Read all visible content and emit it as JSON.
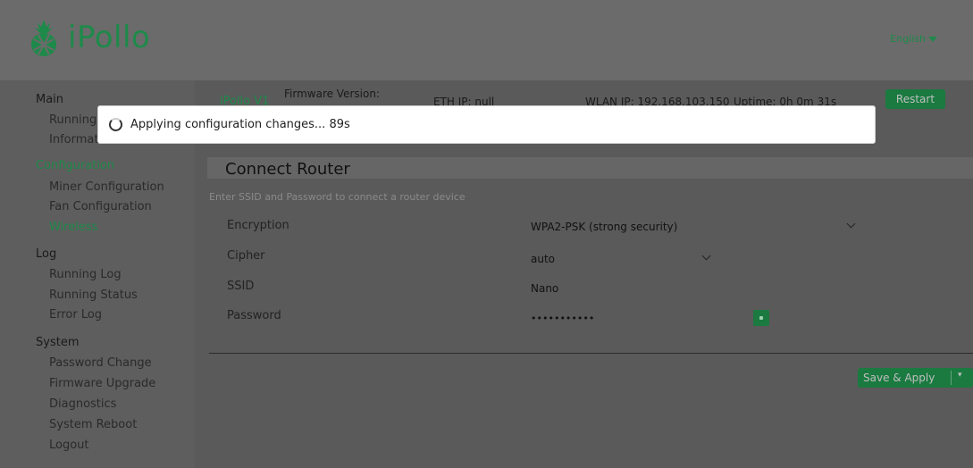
{
  "header": {
    "app_name": "iPollo",
    "language": "English"
  },
  "sidebar": {
    "sections": [
      {
        "label": "Main",
        "items": [
          "Running",
          "Informat"
        ]
      },
      {
        "label": "Configuration",
        "items": [
          "Miner Configuration",
          "Fan Configuration",
          "Wireless"
        ]
      },
      {
        "label": "Log",
        "items": [
          "Running Log",
          "Running Status",
          "Error Log"
        ]
      },
      {
        "label": "System",
        "items": [
          "Password Change",
          "Firmware Upgrade",
          "Diagnostics",
          "System Reboot",
          "Logout"
        ]
      }
    ]
  },
  "status_bar": {
    "model": "iPollo V1",
    "firmware_label": "Firmware Version:",
    "eth_ip": "ETH IP: null",
    "wlan_ip": "WLAN IP: 192.168.103.150",
    "uptime": "Uptime: 0h 0m 31s",
    "restart_label": "Restart"
  },
  "page": {
    "title": "Connect Router",
    "hint": "Enter SSID and Password to connect a router device",
    "fields": [
      {
        "label": "Encryption",
        "value": "WPA2-PSK (strong security)"
      },
      {
        "label": "Cipher",
        "value": "auto"
      },
      {
        "label": "SSID",
        "value": "Nano"
      },
      {
        "label": "Password",
        "value": "•••••••••••"
      }
    ],
    "save_label": "Save & Apply"
  },
  "modal": {
    "message": "Applying configuration changes... 89s"
  },
  "colors": {
    "accent": "#1e8a4a",
    "overlay_bg": "#5a5a5a",
    "modal_bg": "#ffffff"
  },
  "icons": [
    "pineapple-logo-icon",
    "caret-down-icon",
    "spinner-icon",
    "chevron-down-icon",
    "plus-icon"
  ]
}
